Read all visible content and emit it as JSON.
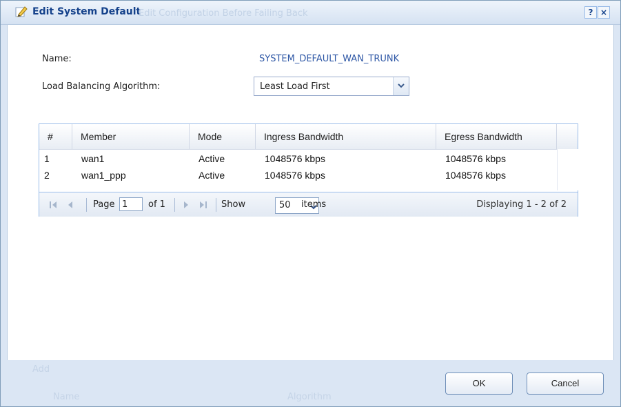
{
  "dialog": {
    "title": "Edit System Default",
    "background_title_ghost": "Edit Configuration Before Failing Back",
    "help_label": "?",
    "close_label": "×"
  },
  "form": {
    "name_label": "Name:",
    "name_value": "SYSTEM_DEFAULT_WAN_TRUNK",
    "algorithm_label": "Load Balancing Algorithm:",
    "algorithm_value": "Least Load First"
  },
  "table": {
    "columns": [
      "#",
      "Member",
      "Mode",
      "Ingress Bandwidth",
      "Egress Bandwidth"
    ],
    "rows": [
      {
        "num": "1",
        "member": "wan1",
        "mode": "Active",
        "ingress": "1048576 kbps",
        "egress": "1048576 kbps"
      },
      {
        "num": "2",
        "member": "wan1_ppp",
        "mode": "Active",
        "ingress": "1048576 kbps",
        "egress": "1048576 kbps"
      }
    ]
  },
  "pager": {
    "page_label": "Page",
    "page_value": "1",
    "of_label": "of 1",
    "show_label": "Show",
    "show_value": "50",
    "items_label": "items",
    "display_text": "Displaying 1 - 2 of 2"
  },
  "footer": {
    "ok_label": "OK",
    "cancel_label": "Cancel",
    "ghost_add": "Add",
    "ghost_name": "Name",
    "ghost_algorithm": "Algorithm"
  },
  "colors": {
    "accent": "#15428b",
    "link": "#2f58a6",
    "border": "#99bbe8"
  }
}
